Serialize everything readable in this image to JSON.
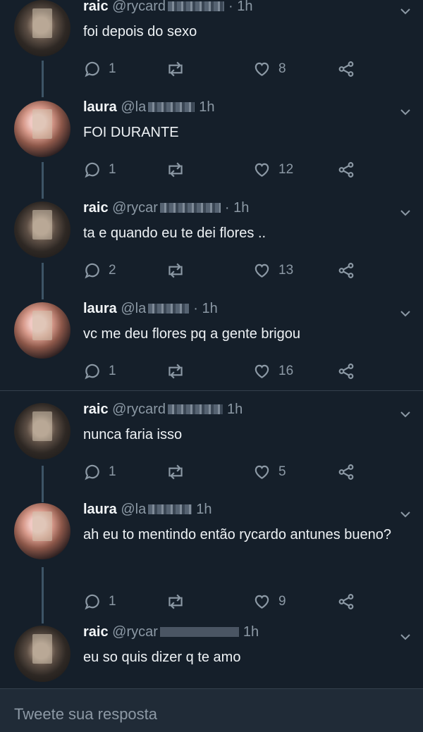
{
  "tweets": [
    {
      "name": "raic",
      "handle": "@rycard",
      "time": "· 1h",
      "text": "foi depois do sexo",
      "replies": "1",
      "likes": "8",
      "avatar": "raic"
    },
    {
      "name": "laura",
      "handle": "@la",
      "time": "1h",
      "text": "FOI DURANTE",
      "replies": "1",
      "likes": "12",
      "avatar": "laura"
    },
    {
      "name": "raic",
      "handle": "@rycar",
      "time": "· 1h",
      "text": "ta e quando eu te dei flores ..",
      "replies": "2",
      "likes": "13",
      "avatar": "raic"
    },
    {
      "name": "laura",
      "handle": "@la",
      "time": "· 1h",
      "text": "vc me deu flores pq a gente brigou",
      "replies": "1",
      "likes": "16",
      "avatar": "laura"
    },
    {
      "name": "raic",
      "handle": "@rycard",
      "time": "1h",
      "text": "nunca faria isso",
      "replies": "1",
      "likes": "5",
      "avatar": "raic"
    },
    {
      "name": "laura",
      "handle": "@la",
      "time": "1h",
      "text": "ah eu to mentindo então rycardo antunes bueno?",
      "replies": "1",
      "likes": "9",
      "avatar": "laura"
    },
    {
      "name": "raic",
      "handle": "@rycar",
      "time": "1h",
      "text": "eu so quis dizer q te amo",
      "replies": "",
      "likes": "",
      "avatar": "raic"
    }
  ],
  "composer": {
    "placeholder": "Tweete sua resposta"
  },
  "icons": {
    "reply": "reply-icon",
    "retweet": "retweet-icon",
    "like": "heart-icon",
    "share": "share-icon",
    "menu": "chevron-down-icon"
  },
  "colors": {
    "background": "#151f2a",
    "text": "#eef2f5",
    "muted": "#8c99a5",
    "thread": "#3d5466"
  }
}
